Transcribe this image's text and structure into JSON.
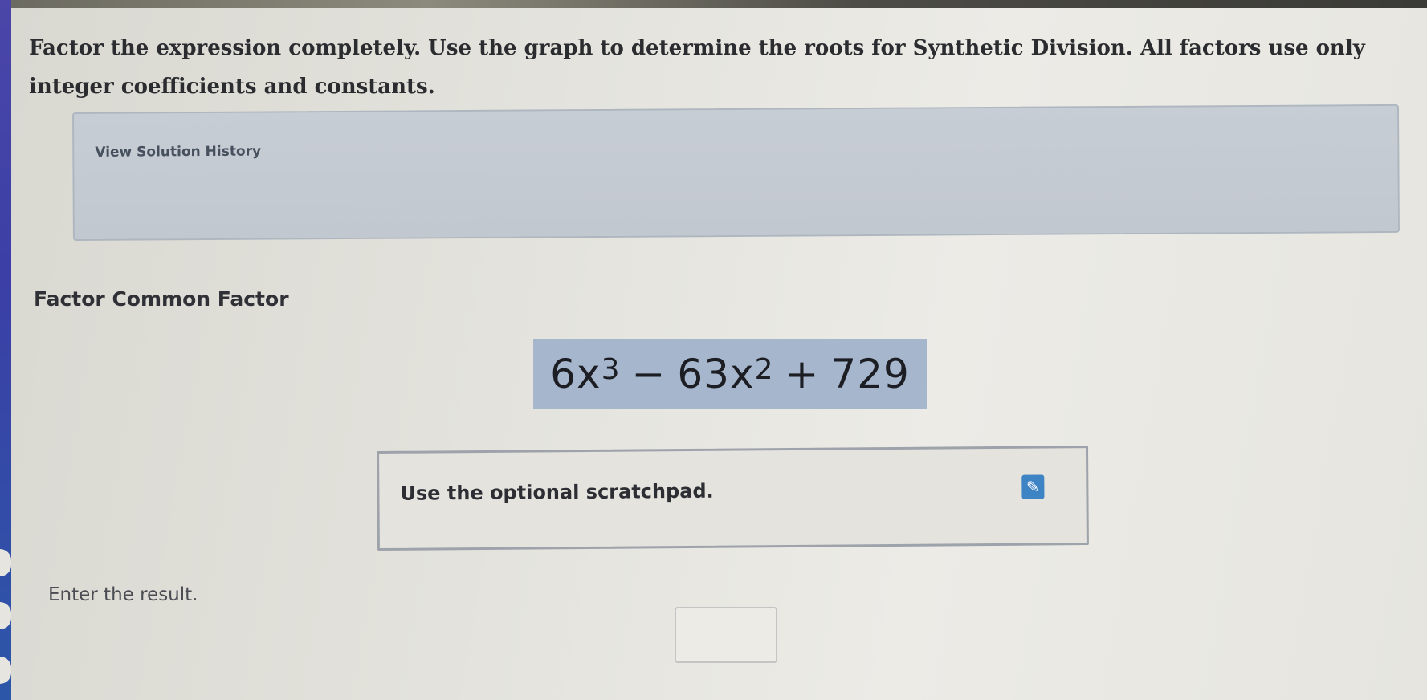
{
  "question": {
    "instructions": "Factor the expression completely. Use the graph to determine the roots for Synthetic Division. All factors use only integer coefficients and constants."
  },
  "history": {
    "link_label": "View Solution History"
  },
  "step": {
    "title": "Factor Common Factor"
  },
  "expression": {
    "term1_coef": "6",
    "term1_var": "x",
    "term1_exp": "3",
    "op1": "−",
    "term2_coef": "63",
    "term2_var": "x",
    "term2_exp": "2",
    "op2": "+",
    "term3": "729"
  },
  "scratchpad": {
    "label": "Use the optional scratchpad.",
    "icon": "pencil-icon"
  },
  "answer": {
    "prompt": "Enter the result.",
    "value": ""
  },
  "colors": {
    "expression_highlight": "#a6b6cd",
    "history_panel": "#c5cbd2",
    "scratchpad_button": "#3e83c4",
    "left_rail": "#3b3fa6"
  }
}
